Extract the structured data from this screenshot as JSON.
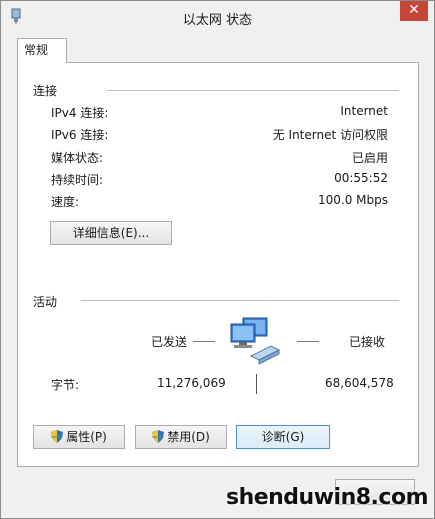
{
  "window": {
    "title": "以太网 状态",
    "close_glyph": "✕",
    "tab_label": "常规"
  },
  "connection": {
    "group_label": "连接",
    "rows": [
      {
        "label": "IPv4 连接:",
        "value": "Internet"
      },
      {
        "label": "IPv6 连接:",
        "value": "无 Internet 访问权限"
      },
      {
        "label": "媒体状态:",
        "value": "已启用"
      },
      {
        "label": "持续时间:",
        "value": "00:55:52"
      },
      {
        "label": "速度:",
        "value": "100.0 Mbps"
      }
    ],
    "details_button": "详细信息(E)..."
  },
  "activity": {
    "group_label": "活动",
    "sent_label": "已发送",
    "received_label": "已接收",
    "bytes_label": "字节:",
    "bytes_sent": "11,276,069",
    "bytes_received": "68,604,578"
  },
  "buttons": {
    "properties": "属性(P)",
    "disable": "禁用(D)",
    "diagnose": "诊断(G)"
  },
  "watermark": "shenduwin8.com"
}
